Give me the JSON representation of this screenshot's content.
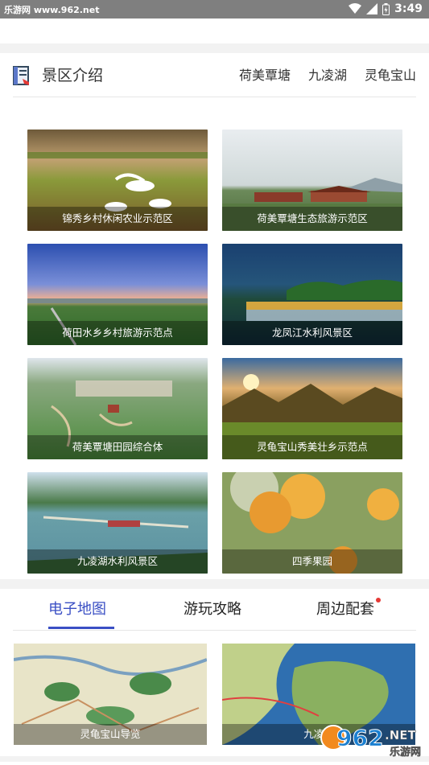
{
  "status_bar": {
    "site": "乐游网 www.962.net",
    "time": "3:49"
  },
  "header": {
    "title": "景区介绍",
    "links": [
      "荷美覃塘",
      "九凌湖",
      "灵龟宝山"
    ]
  },
  "spots": [
    "锦秀乡村休闲农业示范区",
    "荷美覃塘生态旅游示范区",
    "荷田水乡乡村旅游示范点",
    "龙凤江水利风景区",
    "荷美覃塘田园综合体",
    "灵龟宝山秀美壮乡示范点",
    "九凌湖水利风景区",
    "四季果园"
  ],
  "tabs": [
    "电子地图",
    "游玩攻略",
    "周边配套"
  ],
  "maps": [
    "灵龟宝山导览",
    "九凌湖"
  ],
  "watermark": {
    "brand": "962",
    "suffix": ".NET",
    "sub": "乐游网"
  },
  "colors": {
    "accent": "#3a4fc4",
    "badge": "#e53935",
    "statusbar": "#7f7f7f"
  },
  "icons": {
    "header": "book-icon",
    "wifi": "wifi-icon",
    "signal": "signal-icon",
    "battery": "battery-icon"
  }
}
